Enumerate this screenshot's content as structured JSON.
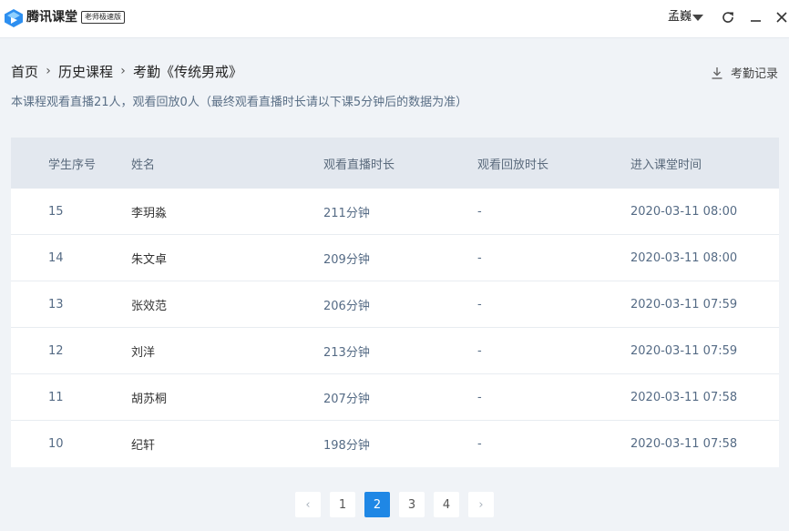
{
  "app": {
    "name": "腾讯课堂",
    "edition": "老师极速版",
    "user": "孟巍"
  },
  "breadcrumb": {
    "items": [
      "首页",
      "历史课程",
      "考勤《传统男戒》"
    ],
    "separator": "›"
  },
  "actions": {
    "attendance_record": "考勤记录"
  },
  "notice": "本课程观看直播21人，观看回放0人（最终观看直播时长请以下课5分钟后的数据为准）",
  "table": {
    "columns": [
      "学生序号",
      "姓名",
      "观看直播时长",
      "观看回放时长",
      "进入课堂时间"
    ],
    "rows": [
      [
        "15",
        "李玥淼",
        "211分钟",
        "-",
        "2020-03-11 08:00"
      ],
      [
        "14",
        "朱文卓",
        "209分钟",
        "-",
        "2020-03-11 08:00"
      ],
      [
        "13",
        "张效范",
        "206分钟",
        "-",
        "2020-03-11 07:59"
      ],
      [
        "12",
        "刘洋",
        "213分钟",
        "-",
        "2020-03-11 07:59"
      ],
      [
        "11",
        "胡苏桐",
        "207分钟",
        "-",
        "2020-03-11 07:58"
      ],
      [
        "10",
        "纪轩",
        "198分钟",
        "-",
        "2020-03-11 07:58"
      ]
    ]
  },
  "pagination": {
    "prev": "‹",
    "next": "›",
    "pages": [
      "1",
      "2",
      "3",
      "4"
    ],
    "current": "2"
  },
  "colors": {
    "accent": "#1f87e5",
    "header_bg": "#e3e8ef",
    "page_bg": "#f0f3f7"
  }
}
